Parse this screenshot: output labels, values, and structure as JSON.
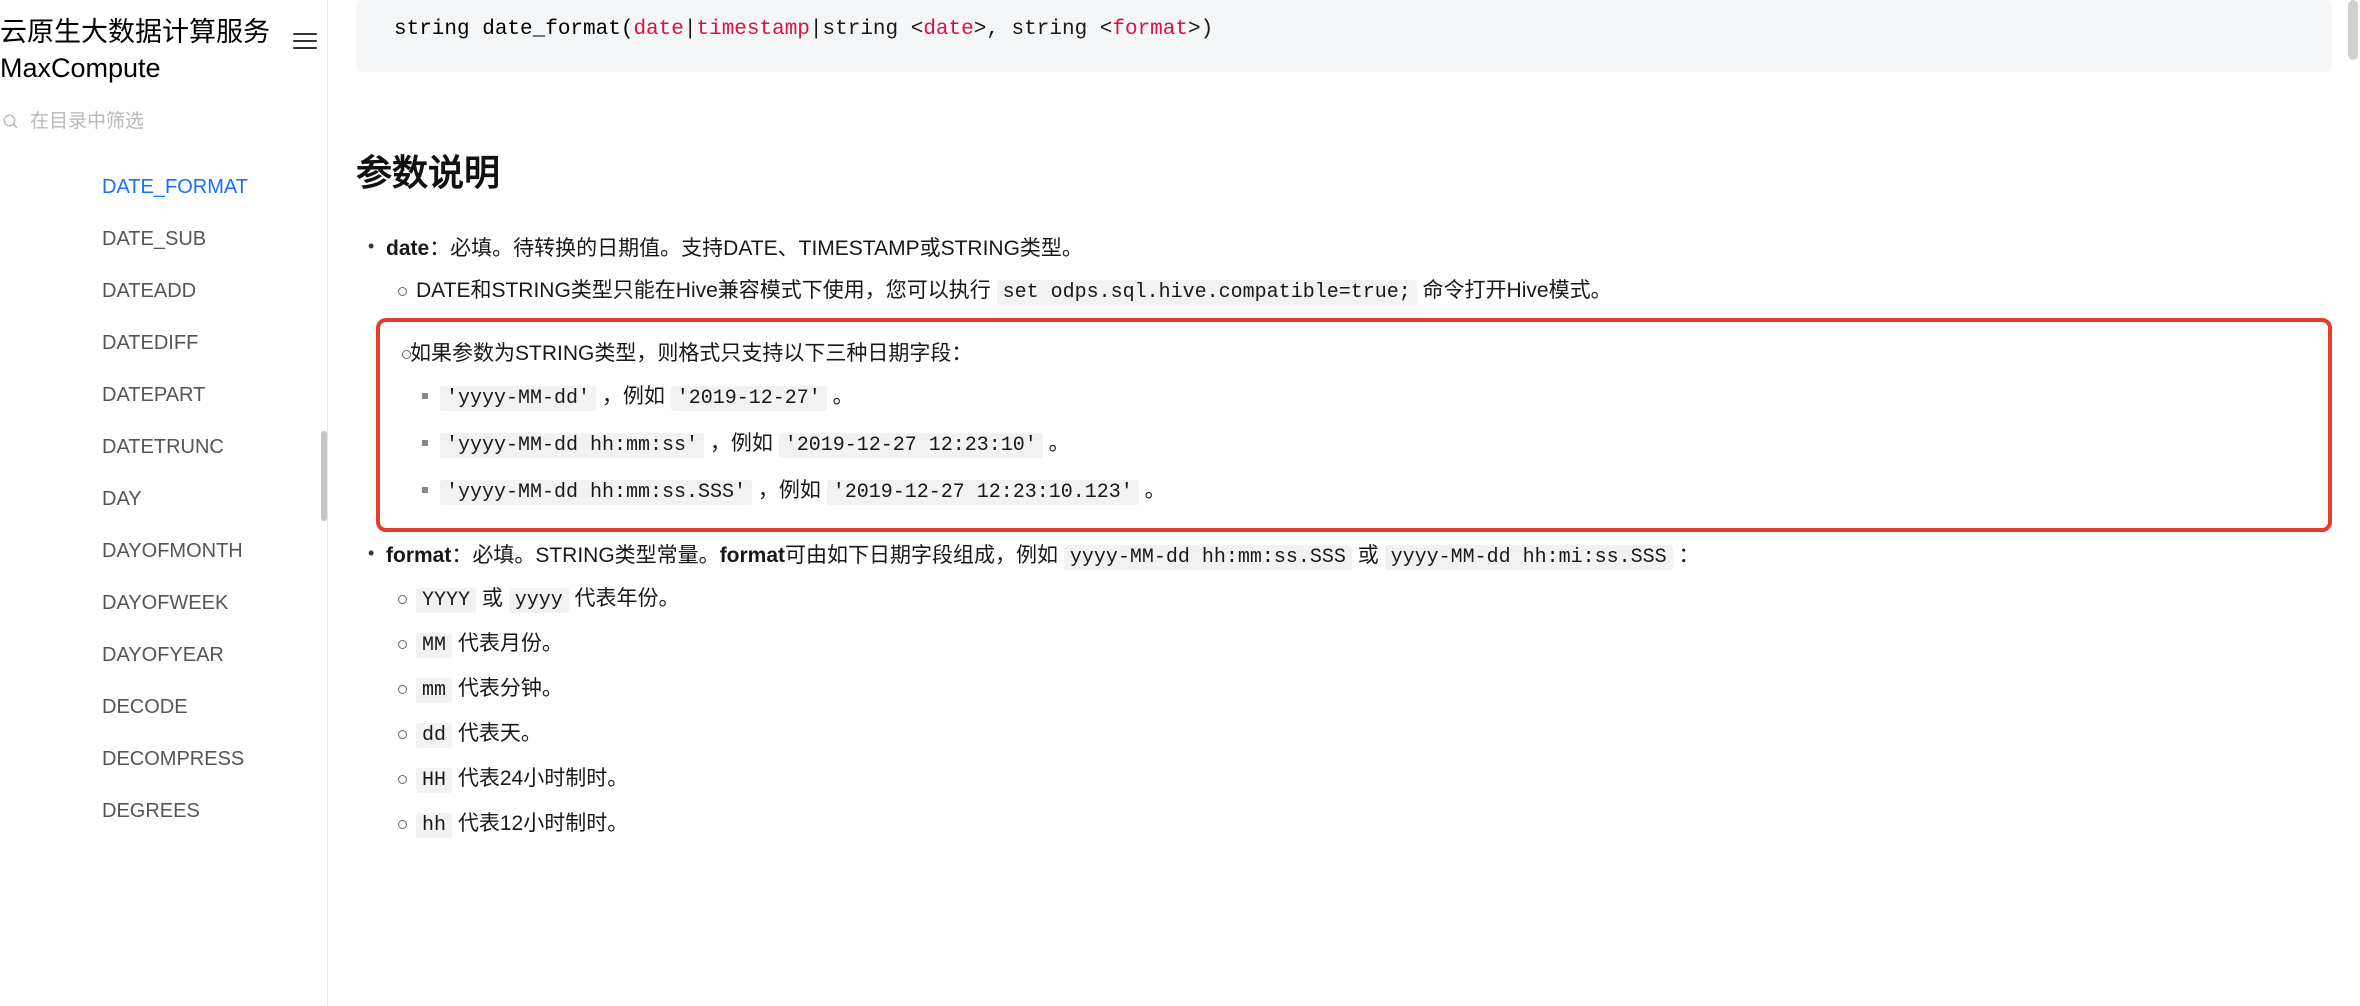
{
  "sidebar": {
    "product_title": "云原生大数据计算服务MaxCompute",
    "search_placeholder": "在目录中筛选",
    "items": [
      {
        "label": "DATE_FORMAT",
        "active": true
      },
      {
        "label": "DATE_SUB"
      },
      {
        "label": "DATEADD"
      },
      {
        "label": "DATEDIFF"
      },
      {
        "label": "DATEPART"
      },
      {
        "label": "DATETRUNC"
      },
      {
        "label": "DAY"
      },
      {
        "label": "DAYOFMONTH"
      },
      {
        "label": "DAYOFWEEK"
      },
      {
        "label": "DAYOFYEAR"
      },
      {
        "label": "DECODE"
      },
      {
        "label": "DECOMPRESS"
      },
      {
        "label": "DEGREES"
      }
    ]
  },
  "code": {
    "prefix": "string date_format(",
    "t_date": "date",
    "pipe1": "|",
    "t_ts": "timestamp",
    "pipe2": "|string <",
    "t_date2": "date",
    "after_date2": ">, string <",
    "t_format": "format",
    "tail": ">)"
  },
  "section_title": "参数说明",
  "p_date": {
    "name": "date",
    "desc": "：必填。待转换的日期值。支持DATE、TIMESTAMP或STRING类型。",
    "sub1_pre": "DATE和STRING类型只能在Hive兼容模式下使用，您可以执行 ",
    "sub1_code": "set odps.sql.hive.compatible=true;",
    "sub1_post": " 命令打开Hive模式。",
    "sub2_intro": "如果参数为STRING类型，则格式只支持以下三种日期字段：",
    "fmt1_code": "'yyyy-MM-dd'",
    "fmt1_mid": " ，例如 ",
    "fmt1_ex": "'2019-12-27'",
    "fmt1_end": " 。",
    "fmt2_code": "'yyyy-MM-dd hh:mm:ss'",
    "fmt2_mid": " ，例如 ",
    "fmt2_ex": "'2019-12-27 12:23:10'",
    "fmt2_end": " 。",
    "fmt3_code": "'yyyy-MM-dd hh:mm:ss.SSS'",
    "fmt3_mid": " ，例如 ",
    "fmt3_ex": "'2019-12-27 12:23:10.123'",
    "fmt3_end": " 。"
  },
  "p_format": {
    "name": "format",
    "pre": "：必填。STRING类型常量。",
    "name2": "format",
    "mid": "可由如下日期字段组成，例如 ",
    "code1": "yyyy-MM-dd hh:mm:ss.SSS",
    "or": " 或 ",
    "code2": "yyyy-MM-dd hh:mi:ss.SSS",
    "tail": " ：",
    "tokens": [
      {
        "code": "YYYY",
        "or": " 或 ",
        "code2": "yyyy",
        "post": " 代表年份。"
      },
      {
        "code": "MM",
        "post": " 代表月份。"
      },
      {
        "code": "mm",
        "post": " 代表分钟。"
      },
      {
        "code": "dd",
        "post": " 代表天。"
      },
      {
        "code": "HH",
        "post": " 代表24小时制时。"
      },
      {
        "code": "hh",
        "post": " 代表12小时制时。"
      }
    ]
  }
}
